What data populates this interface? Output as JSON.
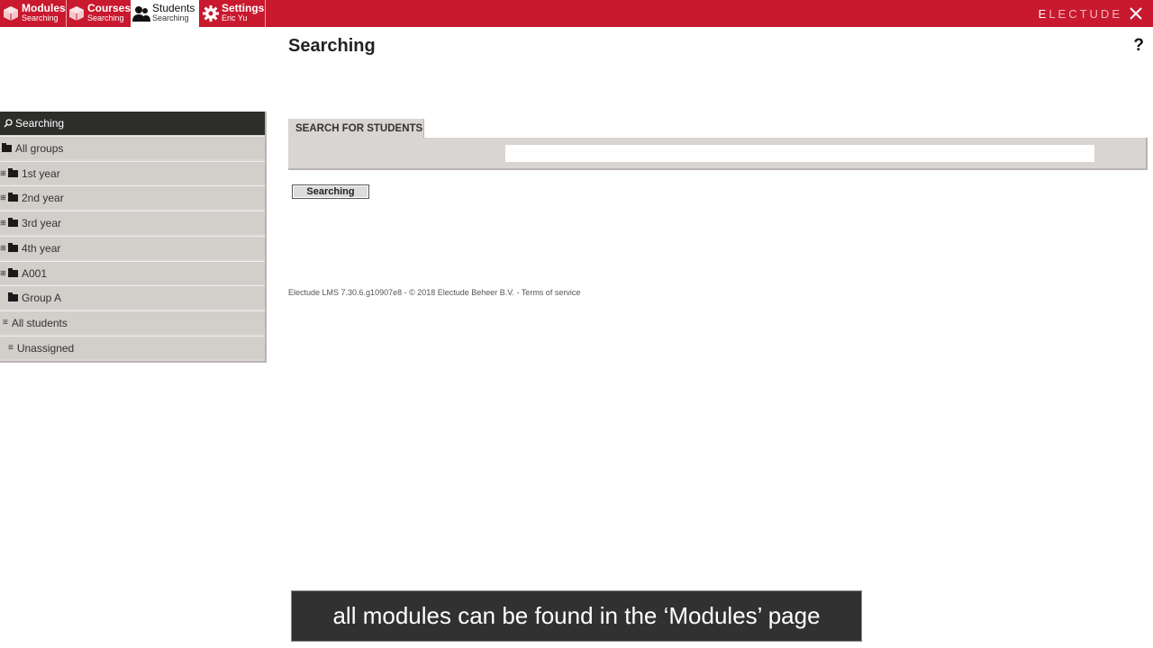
{
  "nav": {
    "tabs": [
      {
        "title": "Modules",
        "subtitle": "Searching",
        "icon": "modules-cube-icon"
      },
      {
        "title": "Courses",
        "subtitle": "Searching",
        "icon": "courses-cube-icon"
      },
      {
        "title": "Students",
        "subtitle": "Searching",
        "icon": "students-people-icon",
        "active": true
      },
      {
        "title": "Settings",
        "subtitle": "Eric Yu",
        "icon": "settings-gear-icon"
      }
    ],
    "brand_first": "E",
    "brand_rest": "LECTUDE",
    "close_icon": "close-icon"
  },
  "help_label": "?",
  "page": {
    "title": "Searching"
  },
  "sidebar": {
    "header": "Searching",
    "items": [
      {
        "label": "All groups"
      },
      {
        "label": "1st year"
      },
      {
        "label": "2nd year"
      },
      {
        "label": "3rd year"
      },
      {
        "label": "4th year"
      },
      {
        "label": "A001"
      },
      {
        "label": "Group A"
      },
      {
        "label": "All students"
      },
      {
        "label": "Unassigned"
      }
    ]
  },
  "search": {
    "tab_label": "SEARCH FOR STUDENTS",
    "input_value": "",
    "button_label": "Searching"
  },
  "footer": {
    "text": "Electude LMS 7.30.6.g10907e8 - © 2018 Electude Beheer B.V. - Terms of service"
  },
  "caption": {
    "text": "all modules can be found in the ‘Modules’ page"
  },
  "colors": {
    "accent": "#c8192e",
    "sidebar_bg": "#d2ceca",
    "sidebar_head": "#2d2d2b"
  }
}
